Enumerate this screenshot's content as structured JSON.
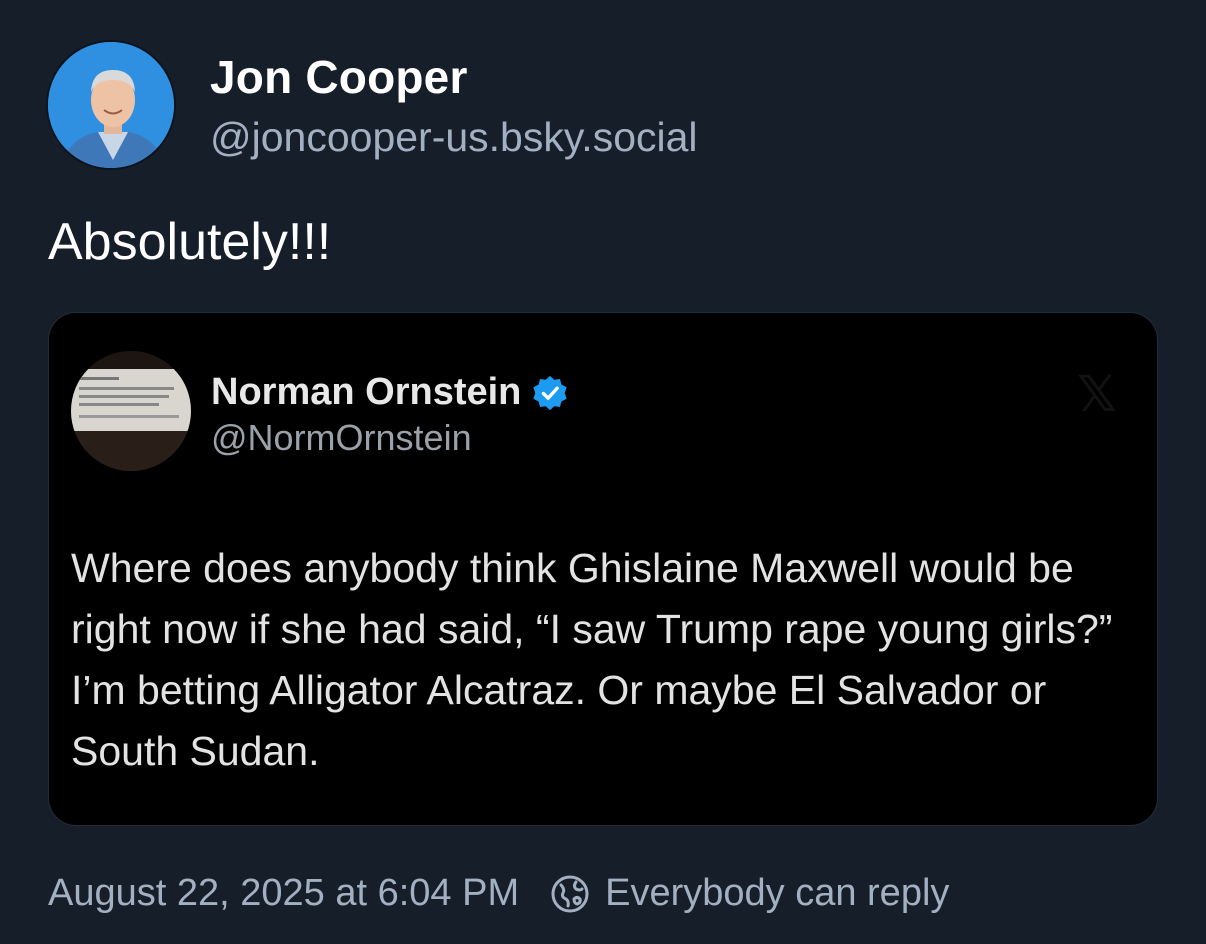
{
  "author": {
    "display_name": "Jon Cooper",
    "handle": "@joncooper-us.bsky.social"
  },
  "post": {
    "text": "Absolutely!!!"
  },
  "quoted_post": {
    "display_name": "Norman Ornstein",
    "handle": "@NormOrnstein",
    "verified": true,
    "text": "Where does anybody think Ghislaine Maxwell would be right now if she had said, “I saw Trump rape young girls?” I’m betting Alligator Alcatraz. Or maybe El Salvador or South Sudan."
  },
  "footer": {
    "timestamp": "August 22, 2025 at 6:04 PM",
    "reply_setting": "Everybody can reply",
    "reply_icon": "globe-icon"
  },
  "colors": {
    "background": "#161e29",
    "card_background": "#000000",
    "muted_text": "#a3b0c2",
    "verified_blue": "#1d9bf0"
  }
}
